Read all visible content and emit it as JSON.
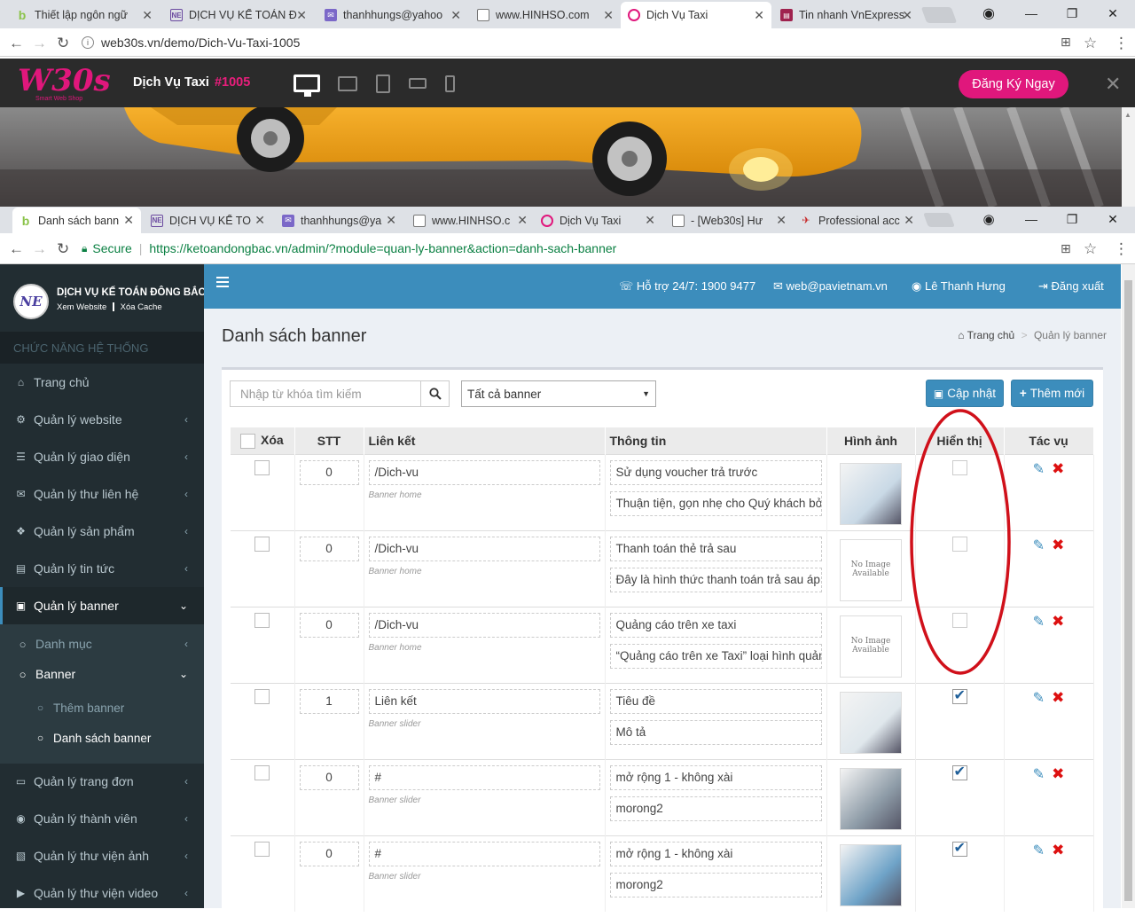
{
  "outer_browser": {
    "tabs": [
      {
        "title": "Thiết lập ngôn ngữ",
        "icon": "b-icon"
      },
      {
        "title": "DỊCH VỤ KẾ TOÁN Đ",
        "icon": "ne-icon"
      },
      {
        "title": "thanhhungs@yahoo",
        "icon": "mail-icon"
      },
      {
        "title": "www.HINHSO.com",
        "icon": "page-icon"
      },
      {
        "title": "Dịch Vụ Taxi",
        "icon": "w-icon"
      },
      {
        "title": "Tin nhanh VnExpress",
        "icon": "news-icon"
      }
    ],
    "url": "web30s.vn/demo/Dich-Vu-Taxi-1005"
  },
  "web30s": {
    "logo_text": "W30s",
    "logo_sub": "Smart Web Shop",
    "title": "Dịch Vụ Taxi",
    "id": "#1005",
    "register_label": "Đăng Ký Ngay"
  },
  "inner_browser": {
    "tabs": [
      {
        "title": "Danh sách bann",
        "icon": "b-icon"
      },
      {
        "title": "DỊCH VỤ KẾ TO",
        "icon": "ne-icon"
      },
      {
        "title": "thanhhungs@ya",
        "icon": "mail-icon"
      },
      {
        "title": "www.HINHSO.c",
        "icon": "page-icon"
      },
      {
        "title": "Dịch Vụ Taxi",
        "icon": "w-icon"
      },
      {
        "title": "- [Web30s] Hư",
        "icon": "page-icon"
      },
      {
        "title": "Professional acc",
        "icon": "pro-icon"
      }
    ],
    "secure_label": "Secure",
    "url": "https://ketoandongbac.vn/admin/?module=quan-ly-banner&action=danh-sach-banner"
  },
  "brand": {
    "name": "DỊCH VỤ KẾ TOÁN ĐÔNG BẮC",
    "link1": "Xem Website",
    "link2": "Xóa Cache"
  },
  "sidebar": {
    "section_header": "CHỨC NĂNG HỆ THỐNG",
    "items": [
      {
        "label": "Trang chủ",
        "icon": "home-icon"
      },
      {
        "label": "Quản lý website",
        "icon": "cogs-icon"
      },
      {
        "label": "Quản lý giao diện",
        "icon": "bars-icon"
      },
      {
        "label": "Quản lý thư liên hệ",
        "icon": "envelope-icon"
      },
      {
        "label": "Quản lý sản phẩm",
        "icon": "cubes-icon"
      },
      {
        "label": "Quản lý tin tức",
        "icon": "newspaper-icon"
      },
      {
        "label": "Quản lý banner",
        "icon": "image-icon"
      },
      {
        "label": "Danh mục",
        "icon": "circle-icon"
      },
      {
        "label": "Banner",
        "icon": "circle-icon"
      },
      {
        "label": "Thêm banner",
        "icon": "circle-icon"
      },
      {
        "label": "Danh sách banner",
        "icon": "circle-icon"
      },
      {
        "label": "Quản lý trang đơn",
        "icon": "laptop-icon"
      },
      {
        "label": "Quản lý thành viên",
        "icon": "user-circle-icon"
      },
      {
        "label": "Quản lý thư viện ảnh",
        "icon": "file-image-icon"
      },
      {
        "label": "Quản lý thư viện video",
        "icon": "file-video-icon"
      }
    ]
  },
  "topbar": {
    "support": "Hỗ trợ 24/7: 1900 9477",
    "email": "web@pavietnam.vn",
    "user": "Lê Thanh Hưng",
    "logout": "Đăng xuất"
  },
  "page": {
    "title": "Danh sách banner",
    "breadcrumb_home": "Trang chủ",
    "breadcrumb_sep": ">",
    "breadcrumb_current": "Quản lý banner"
  },
  "toolbar": {
    "search_placeholder": "Nhập từ khóa tìm kiếm",
    "filter_value": "Tất cả banner",
    "update_label": "Cập nhật",
    "add_label": "Thêm mới"
  },
  "table": {
    "headers": [
      "Xóa",
      "STT",
      "Liên kết",
      "Thông tin",
      "Hình ảnh",
      "Hiển thị",
      "Tác vụ"
    ],
    "rows": [
      {
        "stt": "0",
        "link": "/Dich-vu",
        "type": "Banner home",
        "title": "Sử dụng voucher trả trước",
        "desc": "Thuận tiện, gọn nhẹ cho Quý khách bở",
        "image": "photo",
        "visible": false
      },
      {
        "stt": "0",
        "link": "/Dich-vu",
        "type": "Banner home",
        "title": "Thanh toán thẻ trả sau",
        "desc": "Đây là hình thức thanh toán trả sau áp d",
        "image": "No Image Available",
        "visible": false
      },
      {
        "stt": "0",
        "link": "/Dich-vu",
        "type": "Banner home",
        "title": "Quảng cáo trên xe taxi",
        "desc": "“Quảng cáo trên xe Taxi” loại hình quản",
        "image": "No Image Available",
        "visible": false
      },
      {
        "stt": "1",
        "link": "Liên kết",
        "type": "Banner slider",
        "title": "Tiêu đề",
        "desc": "Mô tả",
        "image": "photo",
        "visible": true
      },
      {
        "stt": "0",
        "link": "#",
        "type": "Banner slider",
        "title": "mở rộng 1 - không xài",
        "desc": "morong2",
        "image": "photo",
        "visible": true
      },
      {
        "stt": "0",
        "link": "#",
        "type": "Banner slider",
        "title": "mở rộng 1 - không xài",
        "desc": "morong2",
        "image": "photo",
        "visible": true
      }
    ]
  },
  "colors": {
    "topbar": "#3c8dbc",
    "sidebar": "#222d32",
    "accent_pink": "#e0177c",
    "annotation_red": "#d0101a",
    "delete_red": "#dd1010",
    "edit_blue": "#3c8dbc"
  }
}
